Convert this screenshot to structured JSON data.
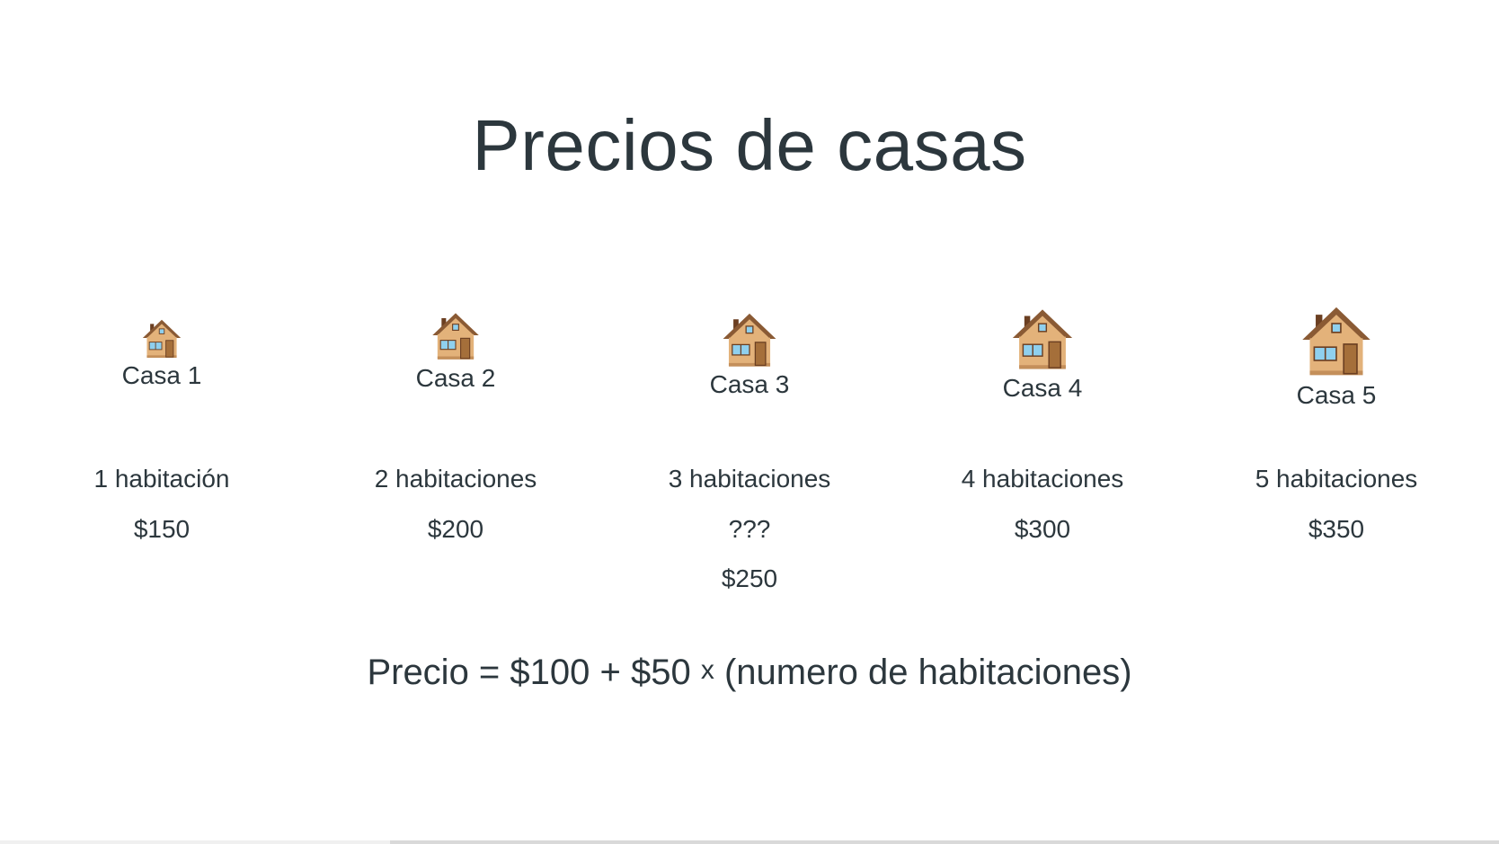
{
  "title": "Precios de casas",
  "houses": [
    {
      "label": "Casa 1",
      "rooms": "1 habitación",
      "price": "$150",
      "icon": "house-icon"
    },
    {
      "label": "Casa 2",
      "rooms": "2 habitaciones",
      "price": "$200",
      "icon": "house-icon"
    },
    {
      "label": "Casa 3",
      "rooms": "3 habitaciones",
      "price": "???",
      "answer": "$250",
      "icon": "house-icon"
    },
    {
      "label": "Casa 4",
      "rooms": "4 habitaciones",
      "price": "$300",
      "icon": "house-icon"
    },
    {
      "label": "Casa 5",
      "rooms": "5 habitaciones",
      "price": "$350",
      "icon": "house-icon"
    }
  ],
  "formula": {
    "left": "Precio = $100 + $50",
    "times": "x",
    "right": "(numero de habitaciones)"
  },
  "colors": {
    "text": "#2c373d",
    "house_wall": "#e3b27a",
    "house_roof": "#8a5a34",
    "window": "#8fd0ee",
    "door": "#a56f3a"
  },
  "progress": 0.26
}
